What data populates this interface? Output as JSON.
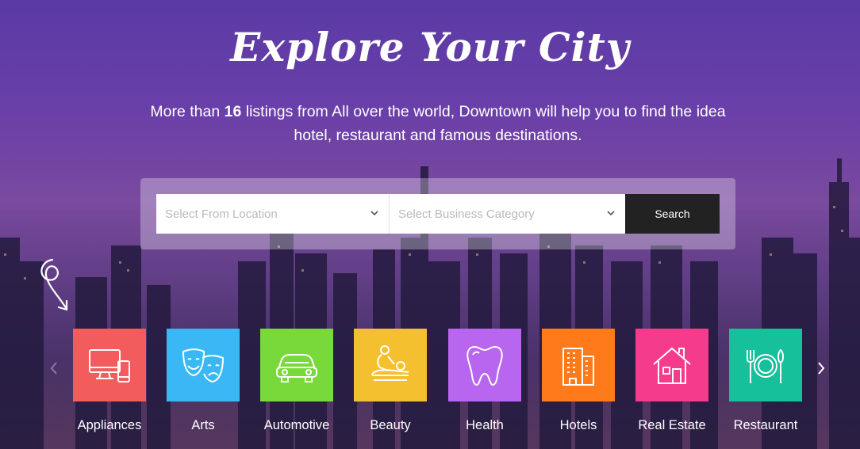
{
  "hero": {
    "title": "Explore Your City",
    "subtitle_pre": "More than ",
    "subtitle_count": "16",
    "subtitle_post": " listings from All over the world, Downtown will help you to find the idea hotel, restaurant and famous destinations."
  },
  "search": {
    "location_placeholder": "Select From Location",
    "category_placeholder": "Select Business Category",
    "button_label": "Search"
  },
  "categories": [
    {
      "label": "Appliances",
      "icon": "appliances-icon",
      "color": "#f25c5c"
    },
    {
      "label": "Arts",
      "icon": "theater-masks-icon",
      "color": "#3ab8f5"
    },
    {
      "label": "Automotive",
      "icon": "car-icon",
      "color": "#7ad93a"
    },
    {
      "label": "Beauty",
      "icon": "massage-icon",
      "color": "#f5c030"
    },
    {
      "label": "Health",
      "icon": "tooth-icon",
      "color": "#b865f0"
    },
    {
      "label": "Hotels",
      "icon": "building-icon",
      "color": "#ff7a1a"
    },
    {
      "label": "Real Estate",
      "icon": "house-icon",
      "color": "#f53c8c"
    },
    {
      "label": "Restaurant",
      "icon": "dining-icon",
      "color": "#15c09a"
    }
  ],
  "colors": {
    "search_button": "#222222",
    "background_top": "#5a3aa6"
  }
}
